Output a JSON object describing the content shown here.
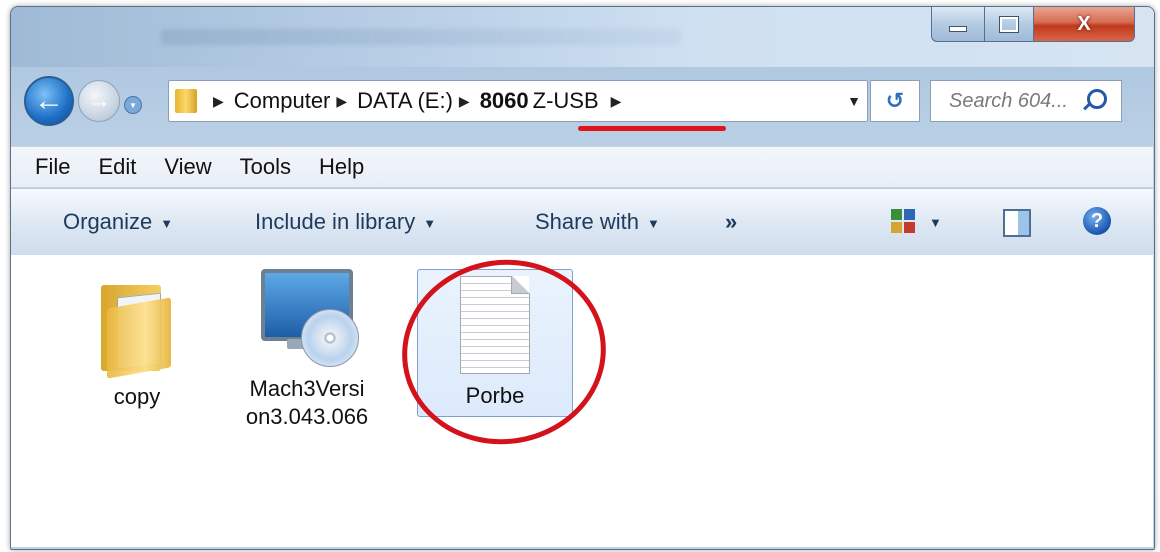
{
  "window": {
    "caption_buttons": {
      "minimize": "—",
      "maximize": "□",
      "close": "X"
    }
  },
  "address_bar": {
    "breadcrumbs": [
      "Computer",
      "DATA (E:)",
      "8060",
      "Z-USB"
    ],
    "search_placeholder": "Search 604..."
  },
  "menu": [
    "File",
    "Edit",
    "View",
    "Tools",
    "Help"
  ],
  "toolbar": {
    "organize": "Organize",
    "include_in_library": "Include in library",
    "share_with": "Share with",
    "more": "»",
    "help_glyph": "?"
  },
  "files": [
    {
      "name": "copy",
      "icon": "folder-icon"
    },
    {
      "name": "Mach3Versi\non3.043.066",
      "icon": "setup-icon"
    },
    {
      "name": "Porbe",
      "icon": "text-file-icon",
      "selected": true
    }
  ],
  "annotations": {
    "underline_color": "#e0131b",
    "circle_color": "#d4121b"
  }
}
